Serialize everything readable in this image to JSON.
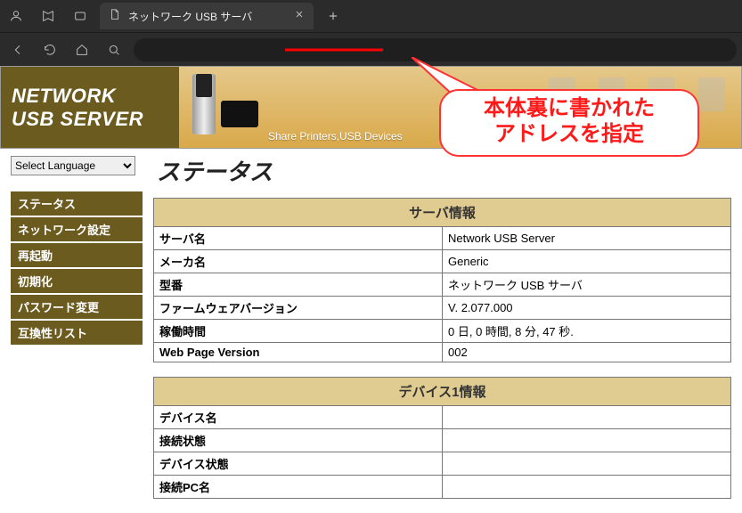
{
  "browser": {
    "tab_title": "ネットワーク USB サーバ"
  },
  "banner": {
    "line1": "NETWORK",
    "line2": "USB SERVER",
    "subtext": "Share Printers,USB Devices"
  },
  "callout": {
    "line1": "本体裏に書かれた",
    "line2": "アドレスを指定"
  },
  "sidebar": {
    "lang_label": "Select Language",
    "items": [
      {
        "label": "ステータス"
      },
      {
        "label": "ネットワーク設定"
      },
      {
        "label": "再起動"
      },
      {
        "label": "初期化"
      },
      {
        "label": "パスワード変更"
      },
      {
        "label": "互換性リスト"
      }
    ]
  },
  "page_title": "ステータス",
  "server_info": {
    "section": "サーバ情報",
    "rows": [
      {
        "k": "サーバ名",
        "v": "Network USB Server"
      },
      {
        "k": "メーカ名",
        "v": "Generic"
      },
      {
        "k": "型番",
        "v": "ネットワーク USB サーバ"
      },
      {
        "k": "ファームウェアバージョン",
        "v": "V. 2.077.000"
      },
      {
        "k": "稼働時間",
        "v": " 0 日, 0 時間, 8 分, 47 秒."
      },
      {
        "k": "Web Page Version",
        "v": "002"
      }
    ]
  },
  "device_info": {
    "section": "デバイス1情報",
    "rows": [
      {
        "k": "デバイス名",
        "v": ""
      },
      {
        "k": "接続状態",
        "v": ""
      },
      {
        "k": "デバイス状態",
        "v": ""
      },
      {
        "k": "接続PC名",
        "v": ""
      }
    ]
  }
}
